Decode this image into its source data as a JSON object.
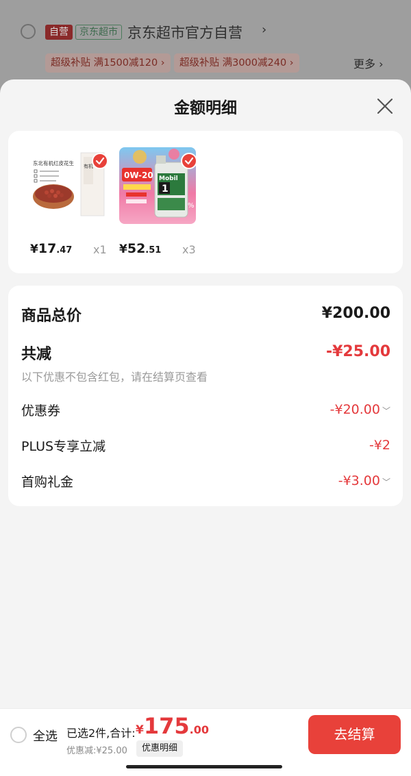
{
  "background_shop": {
    "tag_self": "自营",
    "tag_jd": "京东超市",
    "shop_name": "京东超市官方自营",
    "chevron": "›",
    "coupons": [
      "超级补贴 满1500减120 ›",
      "超级补贴 满3000减240 ›"
    ],
    "more": "更多 ›"
  },
  "sheet": {
    "title": "金额明细",
    "close_icon": "close-icon"
  },
  "products": [
    {
      "image_text": [
        "东北有机红皮花生",
        "有机红皮花生"
      ],
      "price_symbol": "¥",
      "price_int": "17",
      "price_dec": ".47",
      "qty": "x1"
    },
    {
      "image_text": [
        "0W-20",
        "Mobil",
        "1"
      ],
      "price_symbol": "¥",
      "price_int": "52",
      "price_dec": ".51",
      "qty": "x3"
    }
  ],
  "summary": {
    "total_label": "商品总价",
    "total_value": "¥200.00",
    "reduce_label": "共减",
    "reduce_value": "-¥25.00",
    "hint": "以下优惠不包含红包，请在结算页查看",
    "items": [
      {
        "label": "优惠券",
        "value": "-¥20.00",
        "has_chevron": true
      },
      {
        "label": "PLUS专享立减",
        "value": "-¥2",
        "has_chevron": false
      },
      {
        "label": "首购礼金",
        "value": "-¥3.00",
        "has_chevron": true
      }
    ]
  },
  "bottom": {
    "select_all": "全选",
    "selected_text": "已选2件,合计:",
    "total_symbol": "¥",
    "total_int": "175",
    "total_dec": ".00",
    "discount_text": "优惠减:¥25.00",
    "detail_button": "优惠明细",
    "checkout_button": "去结算"
  },
  "colors": {
    "accent": "#e4393c",
    "button": "#e8413a",
    "sheet_bg": "#f4f4f4"
  }
}
